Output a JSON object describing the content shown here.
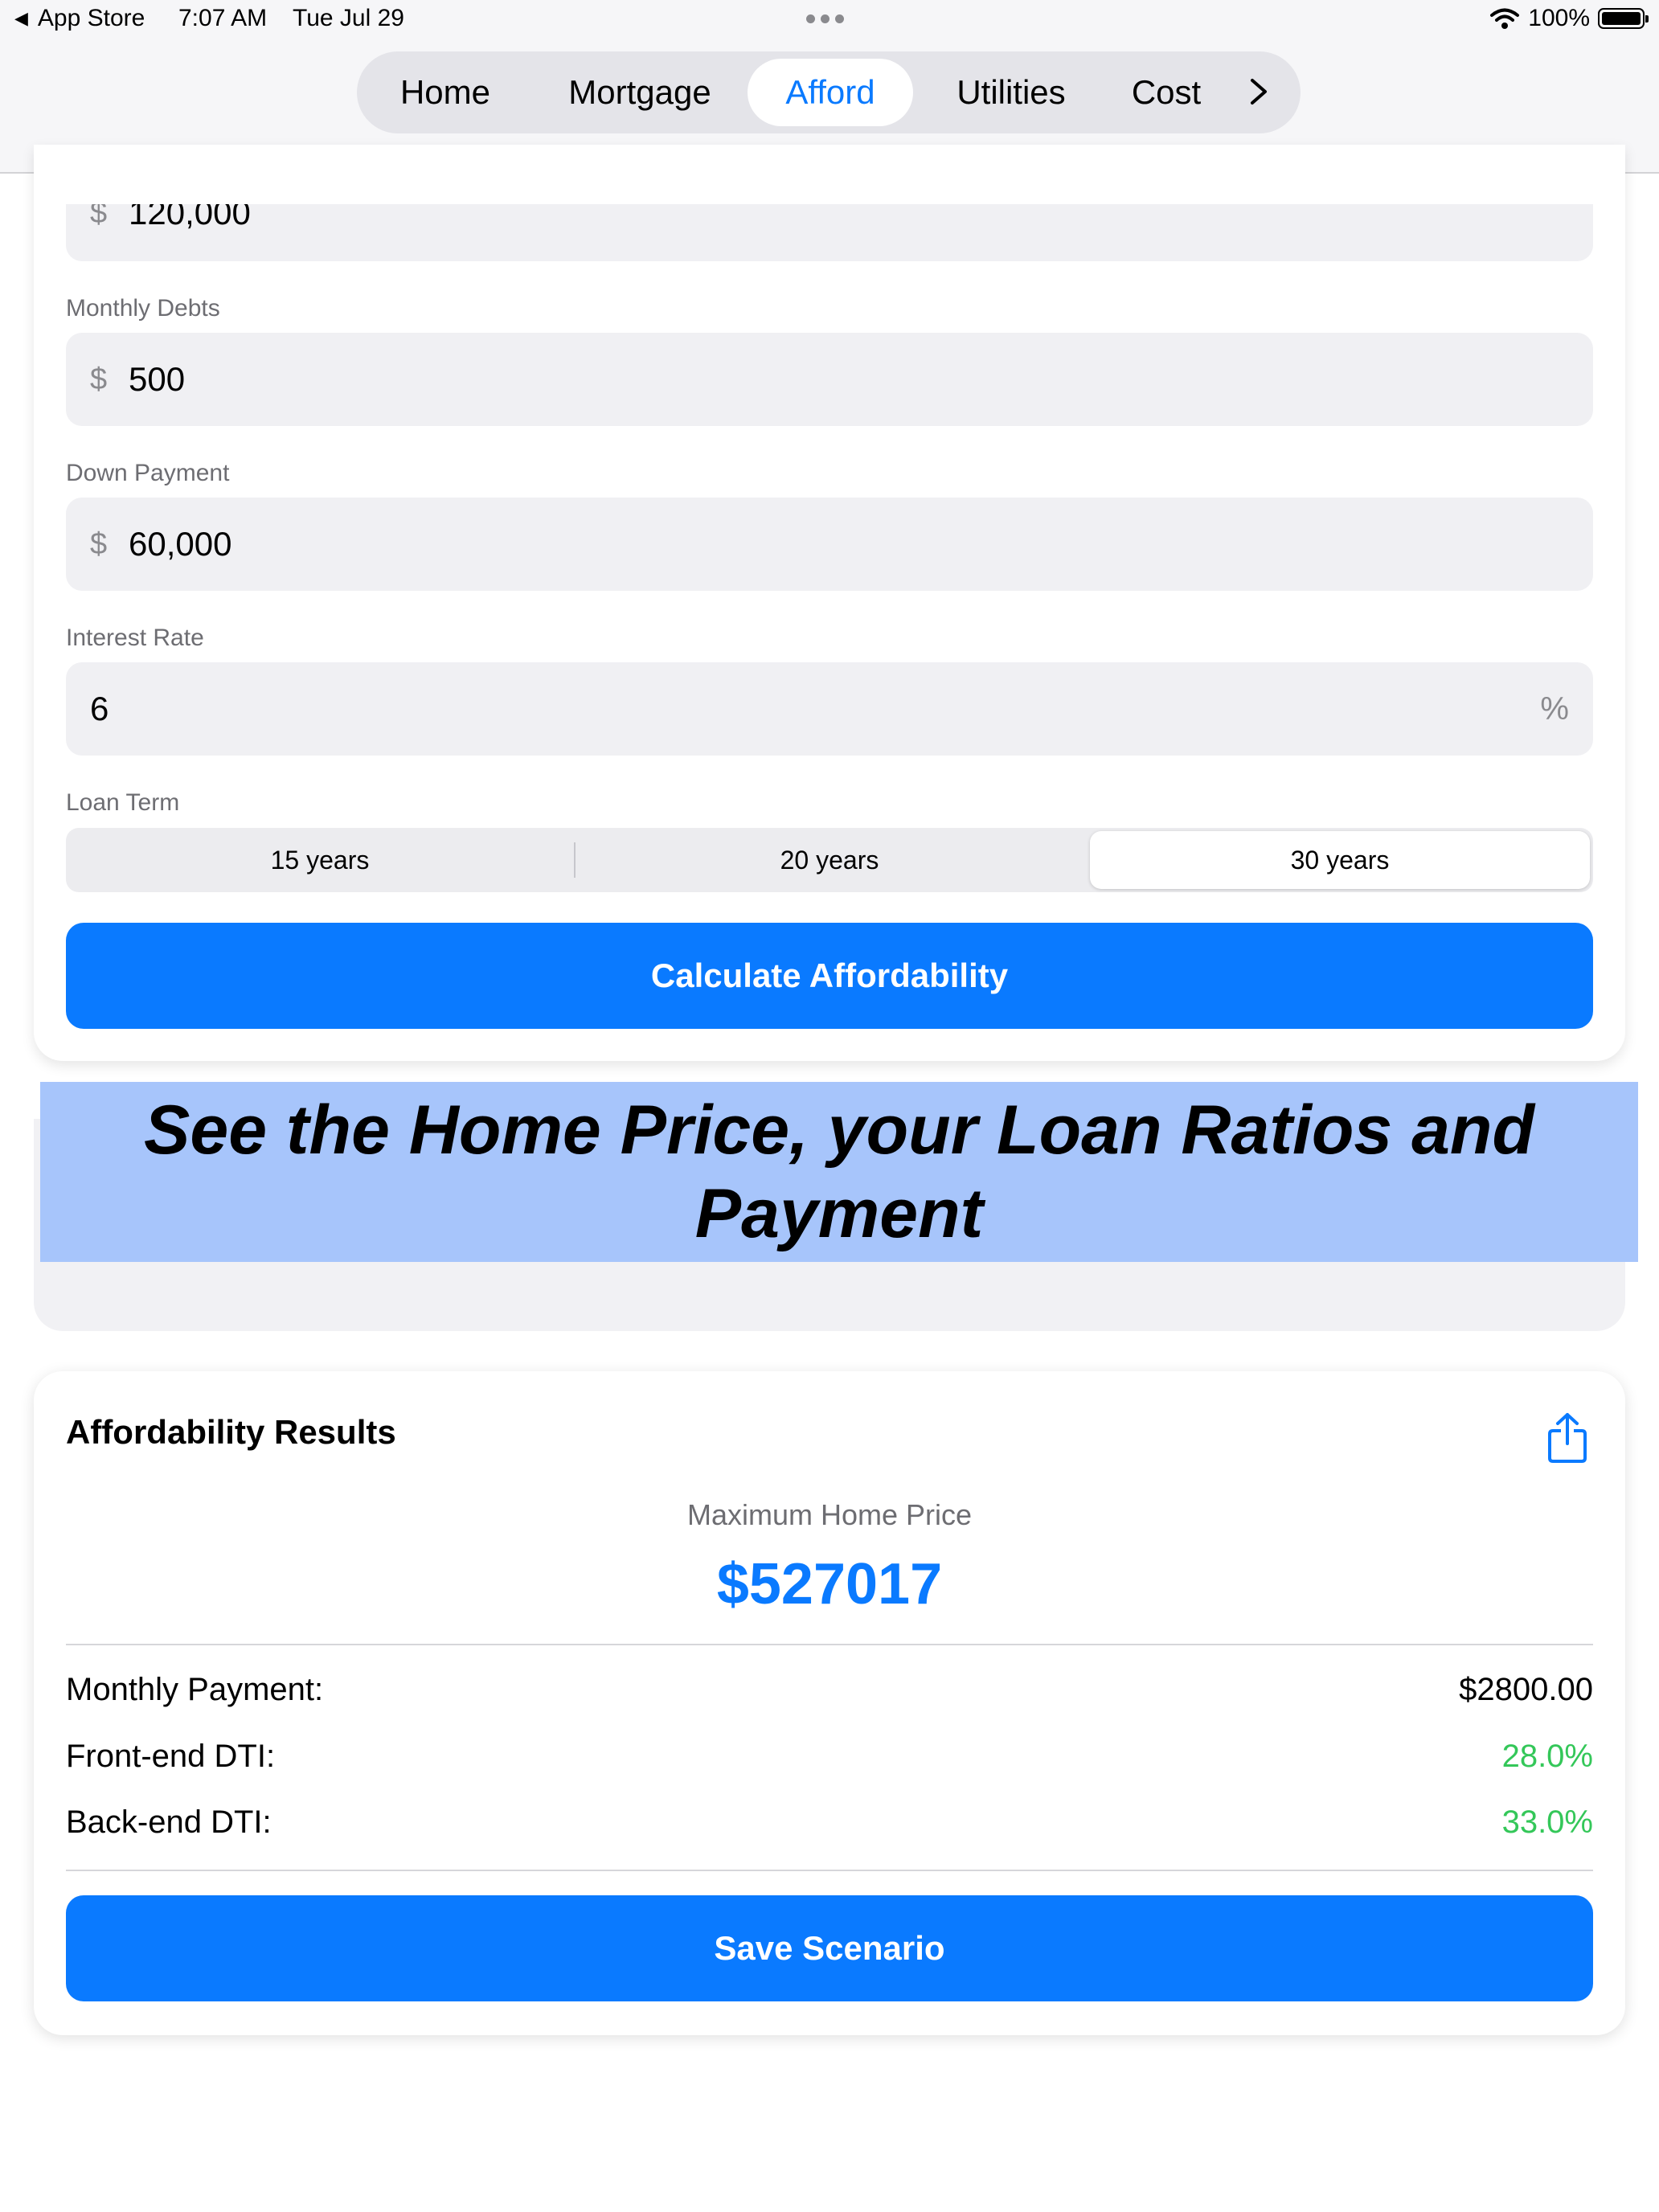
{
  "status_bar": {
    "back_label": "App Store",
    "time": "7:07 AM",
    "date": "Tue Jul 29",
    "battery": "100%"
  },
  "tabs": [
    {
      "label": "Home",
      "active": false
    },
    {
      "label": "Mortgage",
      "active": false
    },
    {
      "label": "Afford",
      "active": true
    },
    {
      "label": "Utilities",
      "active": false
    },
    {
      "label": "Cost",
      "active": false
    }
  ],
  "form": {
    "annual_income": {
      "prefix": "$",
      "value": "120,000"
    },
    "monthly_debts": {
      "label": "Monthly Debts",
      "prefix": "$",
      "value": "500"
    },
    "down_payment": {
      "label": "Down Payment",
      "prefix": "$",
      "value": "60,000"
    },
    "interest_rate": {
      "label": "Interest Rate",
      "value": "6",
      "suffix": "%"
    },
    "loan_term": {
      "label": "Loan Term",
      "options": [
        "15 years",
        "20 years",
        "30 years"
      ],
      "selected": "30 years"
    },
    "calculate_label": "Calculate Affordability"
  },
  "banner": {
    "text": "See the Home Price, your Loan Ratios and Payment"
  },
  "results": {
    "title": "Affordability Results",
    "max_price_label": "Maximum Home Price",
    "max_price_value": "$527017",
    "rows": [
      {
        "label": "Monthly Payment:",
        "value": "$2800.00",
        "color": "#000000"
      },
      {
        "label": "Front-end DTI:",
        "value": "28.0%",
        "color": "#34c759"
      },
      {
        "label": "Back-end DTI:",
        "value": "33.0%",
        "color": "#34c759"
      }
    ],
    "save_label": "Save Scenario"
  },
  "colors": {
    "accent": "#0a7aff",
    "success": "#34c759",
    "banner_bg": "#a7c5fb"
  }
}
